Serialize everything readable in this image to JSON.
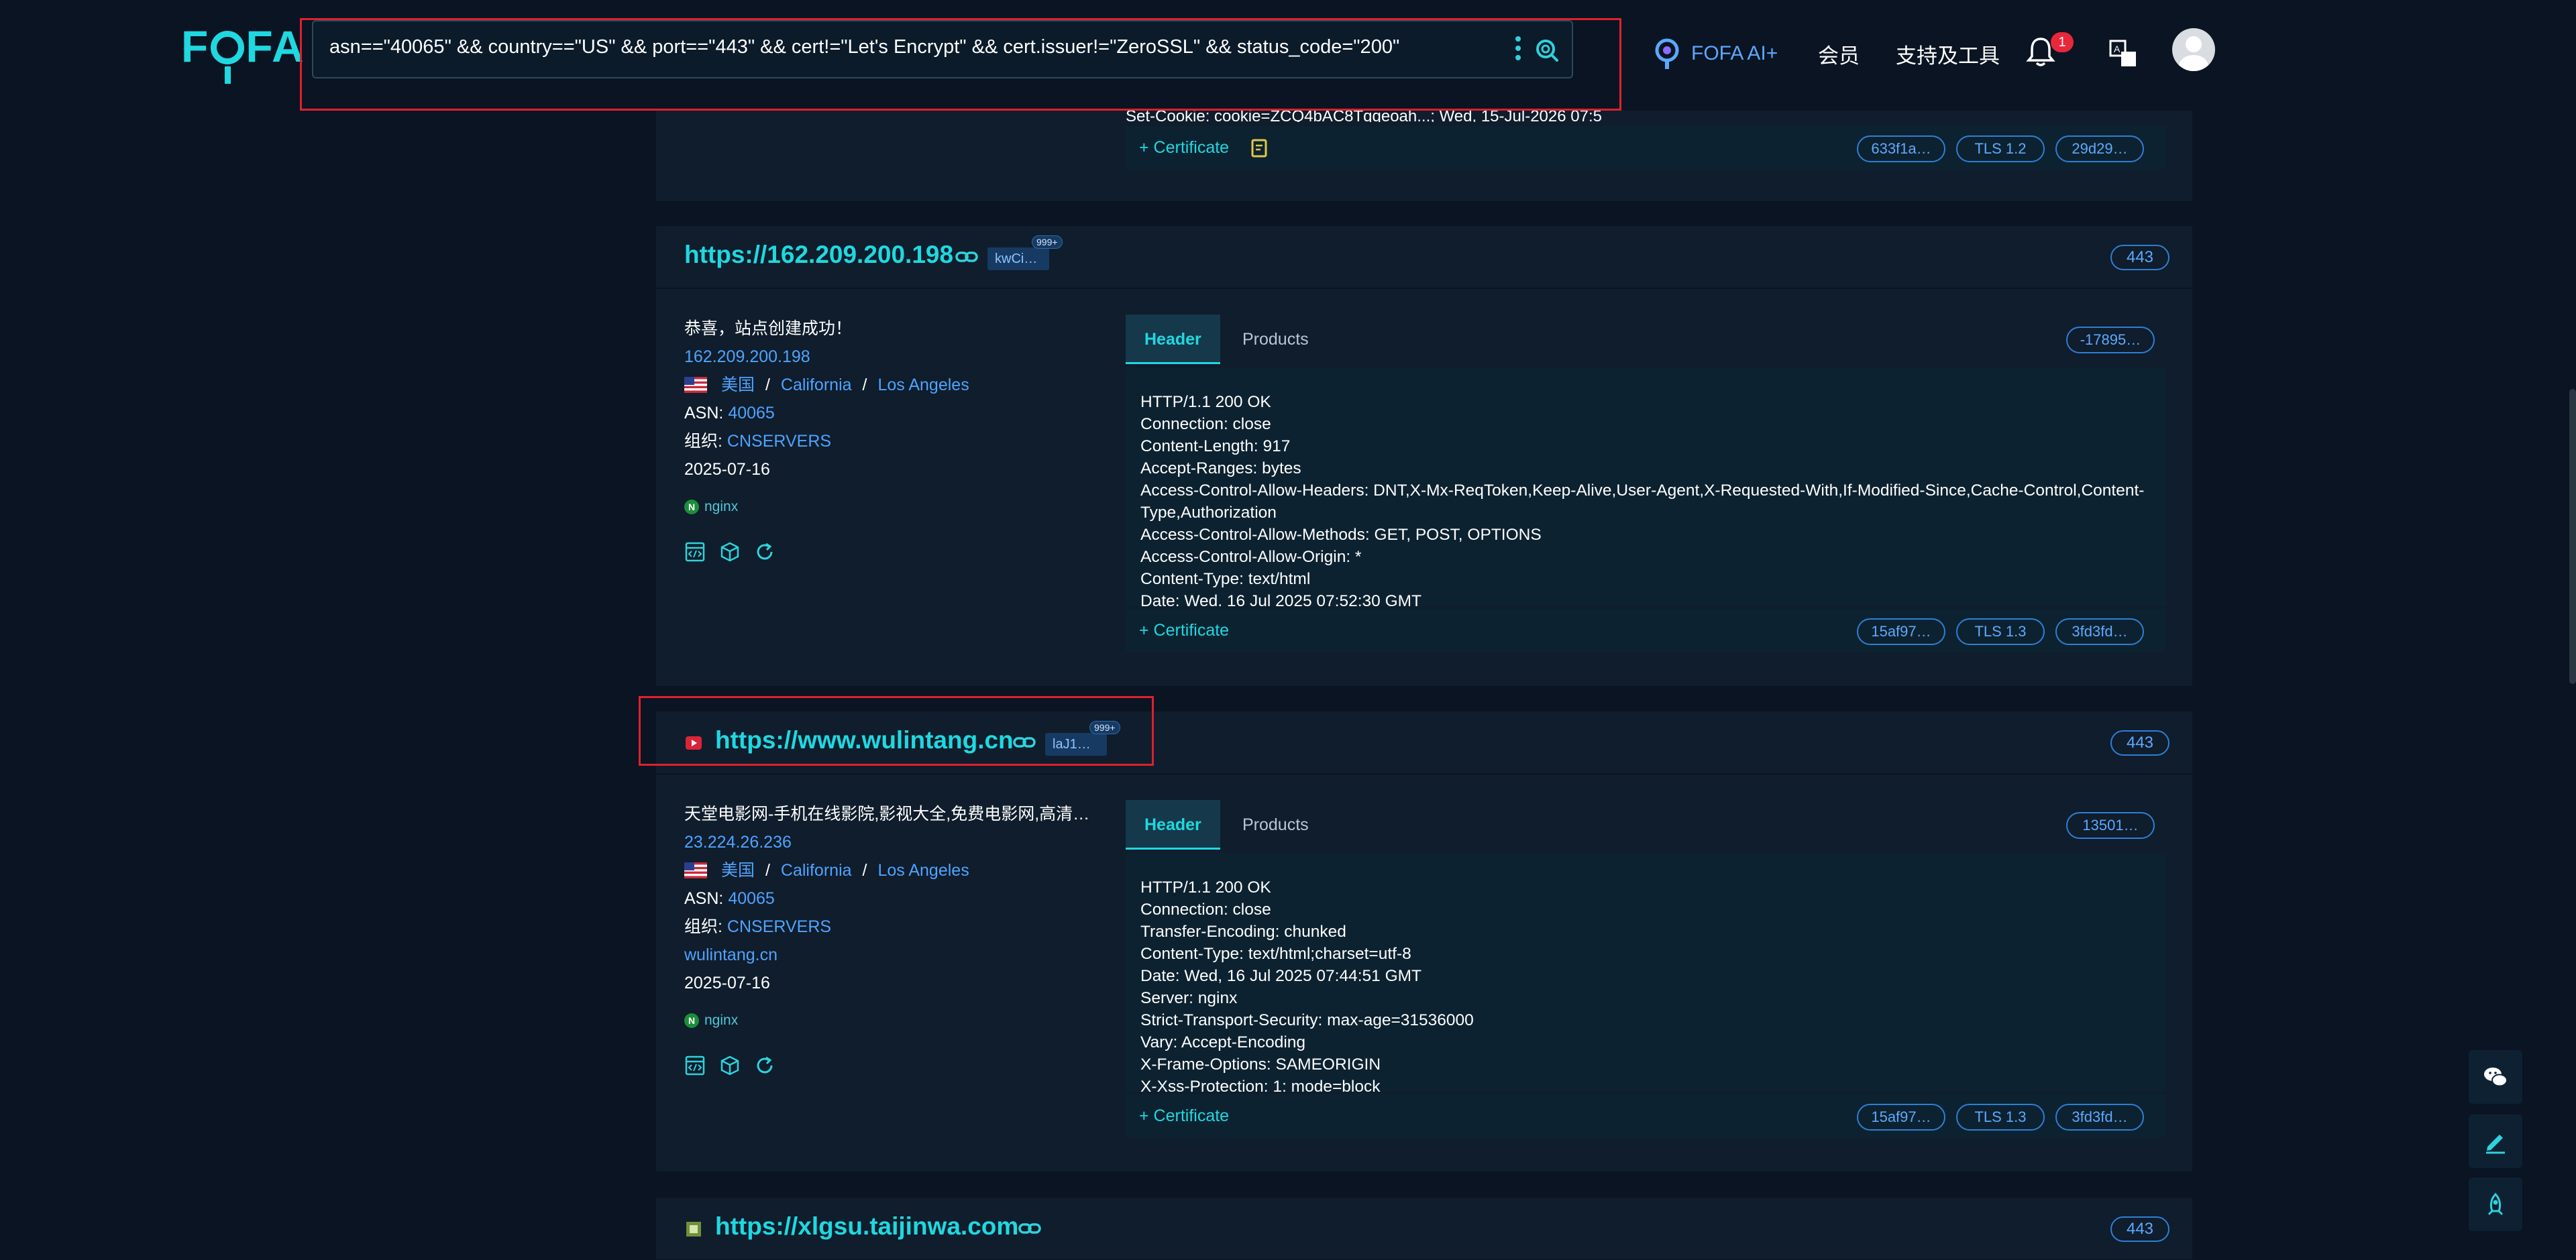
{
  "header": {
    "logo": "FOFA",
    "query": "asn==\"40065\" && country==\"US\" && port==\"443\" && cert!=\"Let's Encrypt\" && cert.issuer!=\"ZeroSSL\" && status_code=\"200\"",
    "ai_label": "FOFA AI+",
    "member_label": "会员",
    "tools_label": "支持及工具",
    "notification_count": "1"
  },
  "top_card": {
    "cert_label": "Certificate",
    "fragment": "Set-Cookie: cookie=ZCQ4bAC8Tqqeoah...; Wed, 15-Jul-2026 07:5",
    "pills": [
      "633f1a…",
      "TLS 1.2",
      "29d29…"
    ]
  },
  "results": [
    {
      "url": "https://162.209.200.198",
      "tag": "kwCi…",
      "tag_count": "999+",
      "port": "443",
      "title": "恭喜，站点创建成功！",
      "ip": "162.209.200.198",
      "country": "美国",
      "region": "California",
      "city": "Los Angeles",
      "asn_label": "ASN:",
      "asn": "40065",
      "org_label": "组织:",
      "org": "CNSERVERS",
      "domain": "",
      "date": "2025-07-16",
      "server": "nginx",
      "tab_header": "Header",
      "tab_products": "Products",
      "hash": "-17895…",
      "response": [
        "HTTP/1.1 200 OK",
        "Connection: close",
        "Content-Length: 917",
        "Accept-Ranges: bytes",
        "Access-Control-Allow-Headers: DNT,X-Mx-ReqToken,Keep-Alive,User-Agent,X-Requested-With,If-Modified-Since,Cache-Control,Content-Type,Authorization",
        "Access-Control-Allow-Methods: GET, POST, OPTIONS",
        "Access-Control-Allow-Origin: *",
        "Content-Type: text/html",
        "Date: Wed, 16 Jul 2025 07:52:30 GMT"
      ],
      "cert_label": "Certificate",
      "cert_pills": [
        "15af97…",
        "TLS 1.3",
        "3fd3fd…"
      ]
    },
    {
      "url": "https://www.wulintang.cn",
      "tag": "laJ1…",
      "tag_count": "999+",
      "port": "443",
      "title": "天堂电影网-手机在线影院,影视大全,免费电影网,高清…",
      "ip": "23.224.26.236",
      "country": "美国",
      "region": "California",
      "city": "Los Angeles",
      "asn_label": "ASN:",
      "asn": "40065",
      "org_label": "组织:",
      "org": "CNSERVERS",
      "domain": "wulintang.cn",
      "date": "2025-07-16",
      "server": "nginx",
      "tab_header": "Header",
      "tab_products": "Products",
      "hash": "13501…",
      "response": [
        "HTTP/1.1 200 OK",
        "Connection: close",
        "Transfer-Encoding: chunked",
        "Content-Type: text/html;charset=utf-8",
        "Date: Wed, 16 Jul 2025 07:44:51 GMT",
        "Server: nginx",
        "Strict-Transport-Security: max-age=31536000",
        "Vary: Accept-Encoding",
        "X-Frame-Options: SAMEORIGIN",
        "X-Xss-Protection: 1; mode=block"
      ],
      "cert_label": "Certificate",
      "cert_pills": [
        "15af97…",
        "TLS 1.3",
        "3fd3fd…"
      ]
    },
    {
      "url": "https://xlgsu.taijinwa.com",
      "port": "443"
    }
  ],
  "colors": {
    "background": "#0a1422",
    "card": "#0f1d2c",
    "accent": "#1fd8e0",
    "link": "#4fa3ff",
    "highlight": "#e0202e"
  }
}
